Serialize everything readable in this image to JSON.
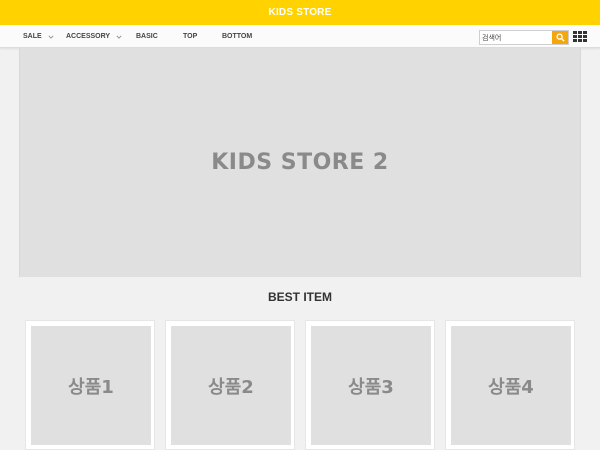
{
  "header": {
    "brand": "KIDS STORE"
  },
  "nav": {
    "items": [
      {
        "label": "SALE",
        "has_dropdown": true
      },
      {
        "label": "ACCESSORY",
        "has_dropdown": true
      },
      {
        "label": "BASIC",
        "has_dropdown": false
      },
      {
        "label": "TOP",
        "has_dropdown": false
      },
      {
        "label": "BOTTOM",
        "has_dropdown": false
      }
    ]
  },
  "search": {
    "value": "검색어",
    "icon": "search-icon",
    "accent": "#f5a60b"
  },
  "menu_icon": "grid-icon",
  "hero": {
    "text": "KIDS STORE 2"
  },
  "best": {
    "title": "BEST ITEM",
    "products": [
      {
        "label": "상품1"
      },
      {
        "label": "상품2"
      },
      {
        "label": "상품3"
      },
      {
        "label": "상품4"
      }
    ]
  },
  "colors": {
    "brand_bar": "#ffd200",
    "placeholder_bg": "#e0e0e0"
  }
}
